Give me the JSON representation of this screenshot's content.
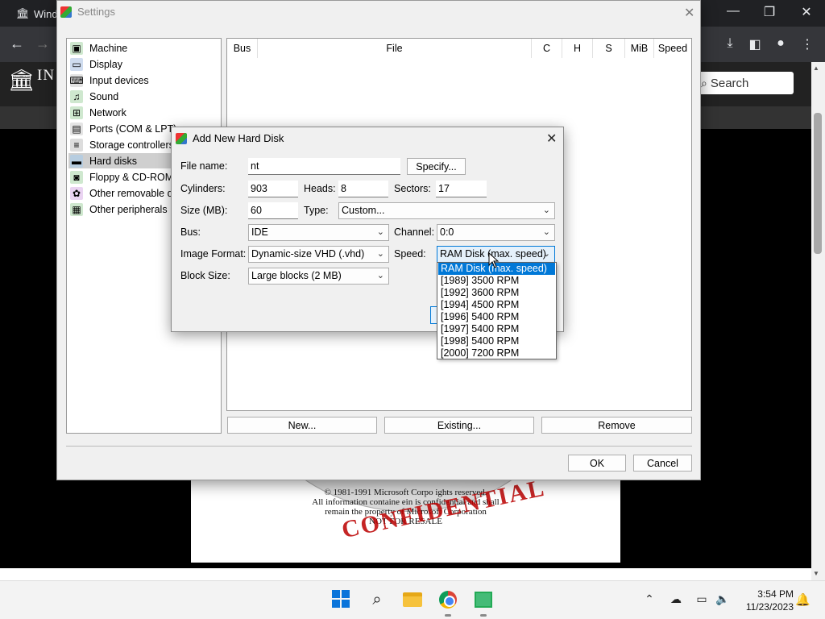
{
  "browser": {
    "tab_title": "Wind",
    "site_logo_text": "IN AR",
    "search_placeholder": "Search"
  },
  "cd": {
    "line1": "© 1981-1991 Microsoft Corpo        ights reserved.",
    "line2": "All information containe     ein is confidential and shall",
    "line3": "remain the property of Microsoft Corporation",
    "line4": "NOT FOR RESALE",
    "stamp": "CONFIDENTIAL"
  },
  "settings": {
    "title": "Settings",
    "tree": [
      {
        "label": "Machine",
        "icon": "machine-icon",
        "color": "#3a7"
      },
      {
        "label": "Display",
        "icon": "display-icon",
        "color": "#37c"
      },
      {
        "label": "Input devices",
        "icon": "input-devices-icon",
        "color": "#777"
      },
      {
        "label": "Sound",
        "icon": "sound-icon",
        "color": "#3a7"
      },
      {
        "label": "Network",
        "icon": "network-icon",
        "color": "#3a7"
      },
      {
        "label": "Ports (COM & LPT)",
        "icon": "ports-icon",
        "color": "#777"
      },
      {
        "label": "Storage controllers",
        "icon": "storage-controllers-icon",
        "color": "#888"
      },
      {
        "label": "Hard disks",
        "icon": "hard-disk-icon",
        "color": "#59a"
      },
      {
        "label": "Floppy & CD-ROM d",
        "icon": "floppy-cdrom-icon",
        "color": "#3a7"
      },
      {
        "label": "Other removable de",
        "icon": "removable-devices-icon",
        "color": "#a4c"
      },
      {
        "label": "Other peripherals",
        "icon": "peripherals-icon",
        "color": "#3a7"
      }
    ],
    "columns": [
      "Bus",
      "File",
      "C",
      "H",
      "S",
      "MiB",
      "Speed"
    ],
    "buttons": {
      "new": "New...",
      "existing": "Existing...",
      "remove": "Remove",
      "ok": "OK",
      "cancel": "Cancel"
    }
  },
  "dialog": {
    "title": "Add New Hard Disk",
    "file_name_label": "File name:",
    "file_name_value": "nt",
    "specify_label": "Specify...",
    "cylinders_label": "Cylinders:",
    "cylinders_value": "903",
    "heads_label": "Heads:",
    "heads_value": "8",
    "sectors_label": "Sectors:",
    "sectors_value": "17",
    "size_label": "Size (MB):",
    "size_value": "60",
    "type_label": "Type:",
    "type_value": "Custom...",
    "bus_label": "Bus:",
    "bus_value": "IDE",
    "channel_label": "Channel:",
    "channel_value": "0:0",
    "format_label": "Image Format:",
    "format_value": "Dynamic-size VHD (.vhd)",
    "speed_label": "Speed:",
    "speed_value": "RAM Disk (max. speed)",
    "block_label": "Block Size:",
    "block_value": "Large blocks (2 MB)"
  },
  "speed_options": [
    "RAM Disk (max. speed)",
    "[1989] 3500 RPM",
    "[1992] 3600 RPM",
    "[1994] 4500 RPM",
    "[1996] 5400 RPM",
    "[1997] 5400 RPM",
    "[1998] 5400 RPM",
    "[2000] 7200 RPM"
  ],
  "taskbar": {
    "time": "3:54 PM",
    "date": "11/23/2023"
  }
}
